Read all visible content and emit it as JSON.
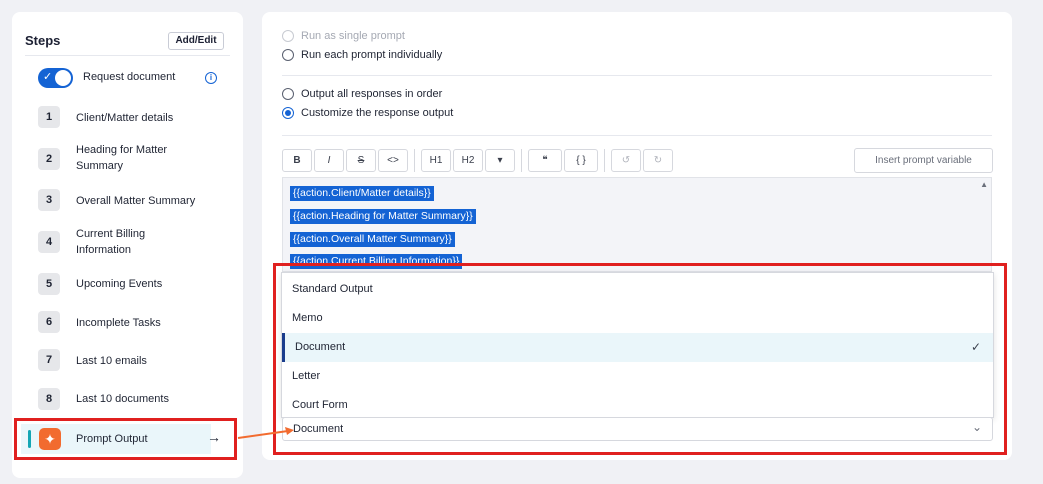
{
  "left_panel": {
    "title": "Steps",
    "add_edit_label": "Add/Edit",
    "request_document_label": "Request document",
    "steps": [
      {
        "num": "1",
        "label": "Client/Matter details"
      },
      {
        "num": "2",
        "label": "Heading for Matter Summary"
      },
      {
        "num": "3",
        "label": "Overall Matter Summary"
      },
      {
        "num": "4",
        "label": "Current Billing Information"
      },
      {
        "num": "5",
        "label": "Upcoming Events"
      },
      {
        "num": "6",
        "label": "Incomplete Tasks"
      },
      {
        "num": "7",
        "label": "Last 10 emails"
      },
      {
        "num": "8",
        "label": "Last 10 documents"
      }
    ],
    "prompt_output_label": "Prompt Output"
  },
  "right_panel": {
    "run_single": "Run as single prompt",
    "run_each": "Run each prompt individually",
    "output_all": "Output all responses in order",
    "customize": "Customize the response output",
    "toolbar": {
      "bold": "B",
      "italic": "I",
      "strike": "S",
      "code": "<>",
      "h1": "H1",
      "h2": "H2",
      "more": "▾",
      "quote": "❝",
      "braces": "{ }",
      "undo": "↺",
      "redo": "↻"
    },
    "insert_variable": "Insert prompt variable",
    "editor_chips": [
      "{{action.Client/Matter details}}",
      "{{action.Heading for Matter Summary}}",
      "{{action.Overall Matter Summary}}",
      "{{action.Current Billing Information}}"
    ],
    "dropdown_options": [
      "Standard Output",
      "Memo",
      "Document",
      "Letter",
      "Court Form"
    ],
    "selected_option": "Document"
  }
}
